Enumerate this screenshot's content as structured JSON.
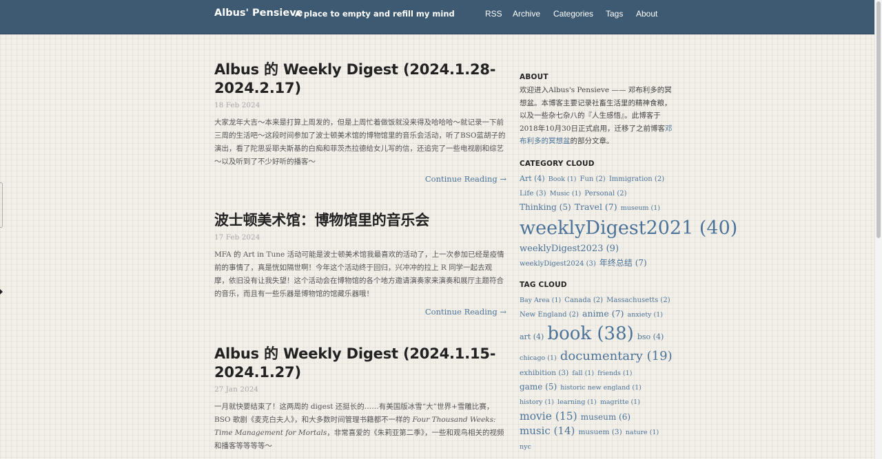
{
  "header": {
    "title": "Albus' Pensieve",
    "subtitle": "A place to empty and refill my mind",
    "nav": [
      "RSS",
      "Archive",
      "Categories",
      "Tags",
      "About"
    ]
  },
  "posts": [
    {
      "title": "Albus 的 Weekly Digest (2024.1.28-2024.2.17)",
      "date": "18 Feb 2024",
      "excerpt": "大家龙年大吉～本来是打算上周发的，但是上周忙着做饭就没来得及哈哈哈～就记录一下前三周的生活吧～这段时间参加了波士顿美术馆的博物馆里的音乐会活动，听了BSO蓝胡子的演出，看了陀思妥耶夫斯基的白痴和菲茨杰拉德给女儿写的信，还追完了一些电视剧和综艺～以及听到了不少好听的播客～",
      "continue": "Continue Reading →"
    },
    {
      "title": "波士顿美术馆：博物馆里的音乐会",
      "date": "17 Feb 2024",
      "excerpt": "MFA 的 Art in Tune 活动可能是波士顿美术馆我最喜欢的活动了，上一次参加已经是疫情前的事情了，真是恍如隔世啊！今年这个活动终于回归，兴冲冲的拉上 R 同学一起去观摩，依旧没有让我失望！这个活动会在博物馆的各个地方邀请演奏家来演奏和展厅主题符合的音乐，而且有一些乐器是博物馆的馆藏乐器哦！",
      "continue": "Continue Reading →"
    },
    {
      "title": "Albus 的 Weekly Digest (2024.1.15-2024.1.27)",
      "date": "27 Jan 2024",
      "excerpt_a": "一月就快要结束了！这两周的 digest 还挺长的……有美国版冰雪“大”世界+雪雕比赛，BSO 歌剧《麦克白夫人》，和大多数时间管理书籍都不一样的 ",
      "excerpt_em": "Four Thousand Weeks: Time Management for Mortals",
      "excerpt_b": "，非常喜爱的《朱莉亚第二季》，一些和观鸟相关的视频和播客等等等等～"
    }
  ],
  "sidebar": {
    "about_heading": "ABOUT",
    "about_text_a": "欢迎进入Albus's Pensieve —— 邓布利多的冥想盆。本博客主要记录社畜生活里的精神食粮，以及一些杂七杂八的『人生感悟』。此博客于2018年10月30日正式启用，迁移了之前博客",
    "about_link": "邓布利多的冥想盆",
    "about_text_b": "的部分文章。",
    "category_heading": "CATEGORY CLOUD",
    "categories": [
      {
        "label": "Art (4)",
        "size": 11
      },
      {
        "label": "Book (1)",
        "size": 9.5
      },
      {
        "label": "Fun (2)",
        "size": 10
      },
      {
        "label": "Immigration (2)",
        "size": 10
      },
      {
        "label": "Life (3)",
        "size": 10.5
      },
      {
        "label": "Music (1)",
        "size": 9.5
      },
      {
        "label": "Personal (2)",
        "size": 10
      },
      {
        "label": "Thinking (5)",
        "size": 12
      },
      {
        "label": "Travel (7)",
        "size": 12.5
      },
      {
        "label": "museum (1)",
        "size": 9.5
      },
      {
        "label": "weeklyDigest2021 (40)",
        "size": 27
      },
      {
        "label": "weeklyDigest2023 (9)",
        "size": 13
      },
      {
        "label": "weeklyDigest2024 (3)",
        "size": 10
      },
      {
        "label": "年终总结 (7)",
        "size": 12
      }
    ],
    "tag_heading": "TAG CLOUD",
    "tags": [
      {
        "label": "Bay Area (1)",
        "size": 9.5
      },
      {
        "label": "Canada (2)",
        "size": 10
      },
      {
        "label": "Massachusetts (2)",
        "size": 10
      },
      {
        "label": "New England (2)",
        "size": 10
      },
      {
        "label": "anime (7)",
        "size": 12.5
      },
      {
        "label": "anxiety (1)",
        "size": 9.5
      },
      {
        "label": "art (4)",
        "size": 11
      },
      {
        "label": "book (38)",
        "size": 26
      },
      {
        "label": "bso (4)",
        "size": 11
      },
      {
        "label": "chicago (1)",
        "size": 9.5
      },
      {
        "label": "documentary (19)",
        "size": 18
      },
      {
        "label": "exhibition (3)",
        "size": 10.5
      },
      {
        "label": "fall (1)",
        "size": 9.5
      },
      {
        "label": "friends (1)",
        "size": 9.5
      },
      {
        "label": "game (5)",
        "size": 12
      },
      {
        "label": "historic new england (1)",
        "size": 9.5
      },
      {
        "label": "history (1)",
        "size": 9.5
      },
      {
        "label": "learning (1)",
        "size": 9.5
      },
      {
        "label": "magritte (1)",
        "size": 9.5
      },
      {
        "label": "movie (15)",
        "size": 15.5
      },
      {
        "label": "museum (6)",
        "size": 12
      },
      {
        "label": "music (14)",
        "size": 15
      },
      {
        "label": "musuem (3)",
        "size": 10.5
      },
      {
        "label": "nature (1)",
        "size": 9.5
      },
      {
        "label": "nyc",
        "size": 9.5
      }
    ]
  }
}
